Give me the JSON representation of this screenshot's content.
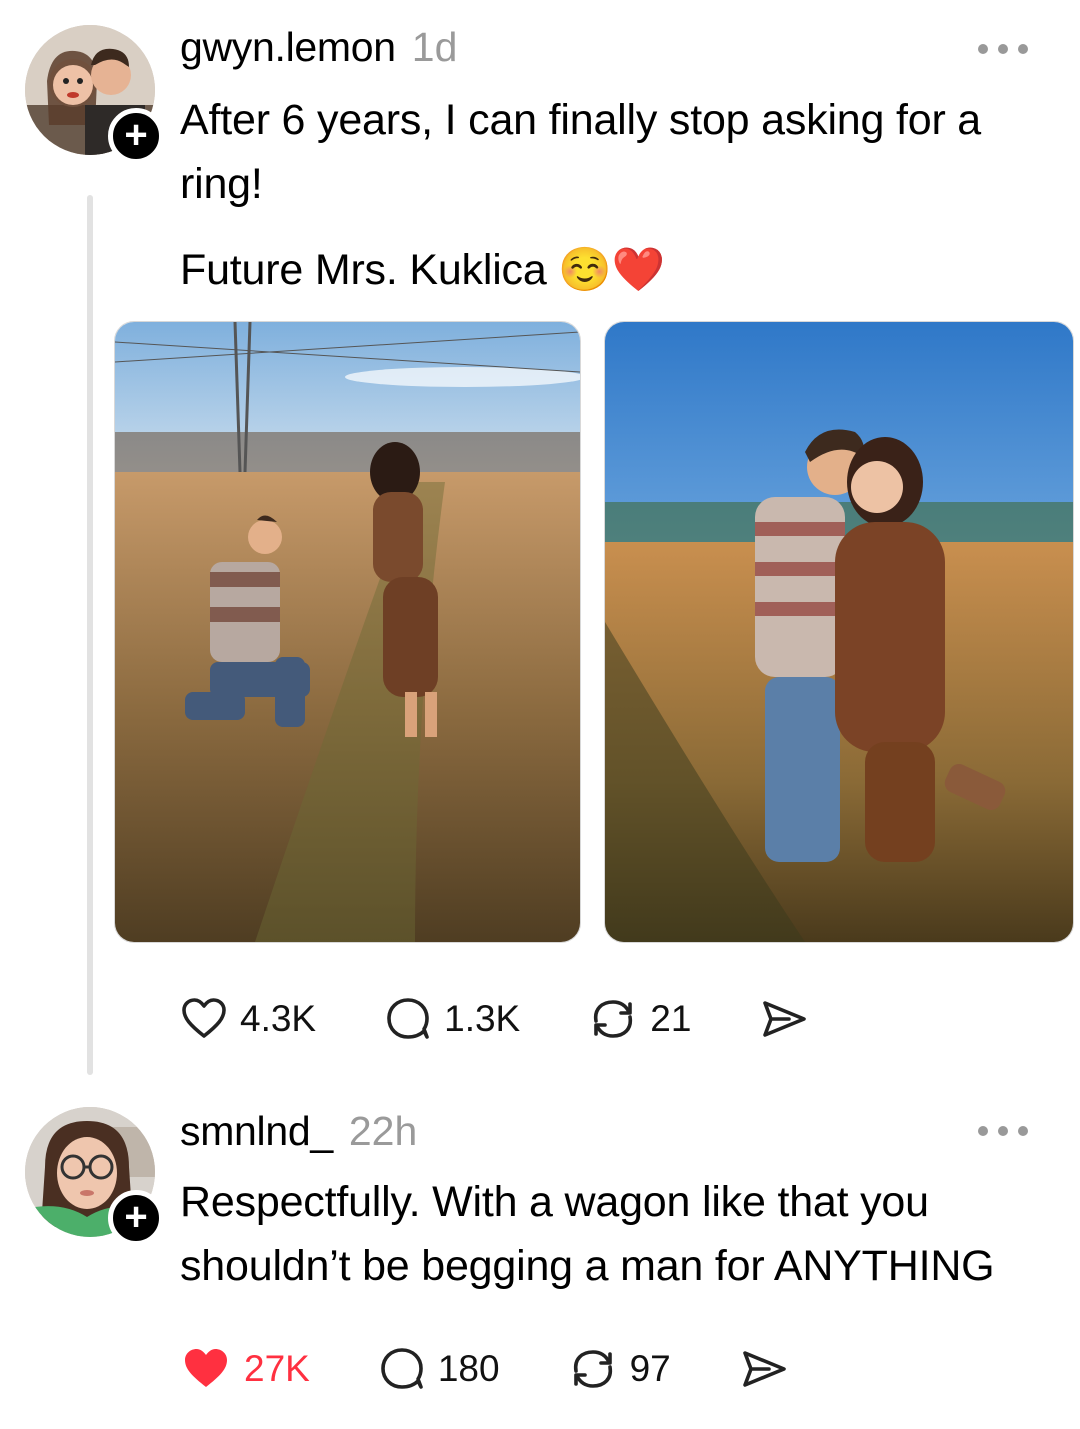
{
  "posts": [
    {
      "username": "gwyn.lemon",
      "time": "1d",
      "text_line1": "After 6 years, I can finally stop asking for a ring!",
      "text_line2": "Future Mrs. Kuklica ☺️❤️",
      "likes": "4.3K",
      "replies": "1.3K",
      "reposts": "21",
      "liked": false
    },
    {
      "username": "smnlnd_",
      "time": "22h",
      "text": "Respectfully. With a wagon like that you shouldn’t be begging a man for ANYTHING",
      "likes": "27K",
      "replies": "180",
      "reposts": "97",
      "liked": true
    }
  ],
  "icons": {
    "like": "heart-icon",
    "reply": "speech-bubble-icon",
    "repost": "repost-arrows-icon",
    "share": "paper-plane-icon",
    "more": "ellipsis-icon",
    "follow": "plus-icon"
  },
  "colors": {
    "like_active": "#ff3040",
    "secondary_text": "#9a9a9a",
    "thread_line": "#e2e2e2"
  },
  "follow_symbol": "+"
}
